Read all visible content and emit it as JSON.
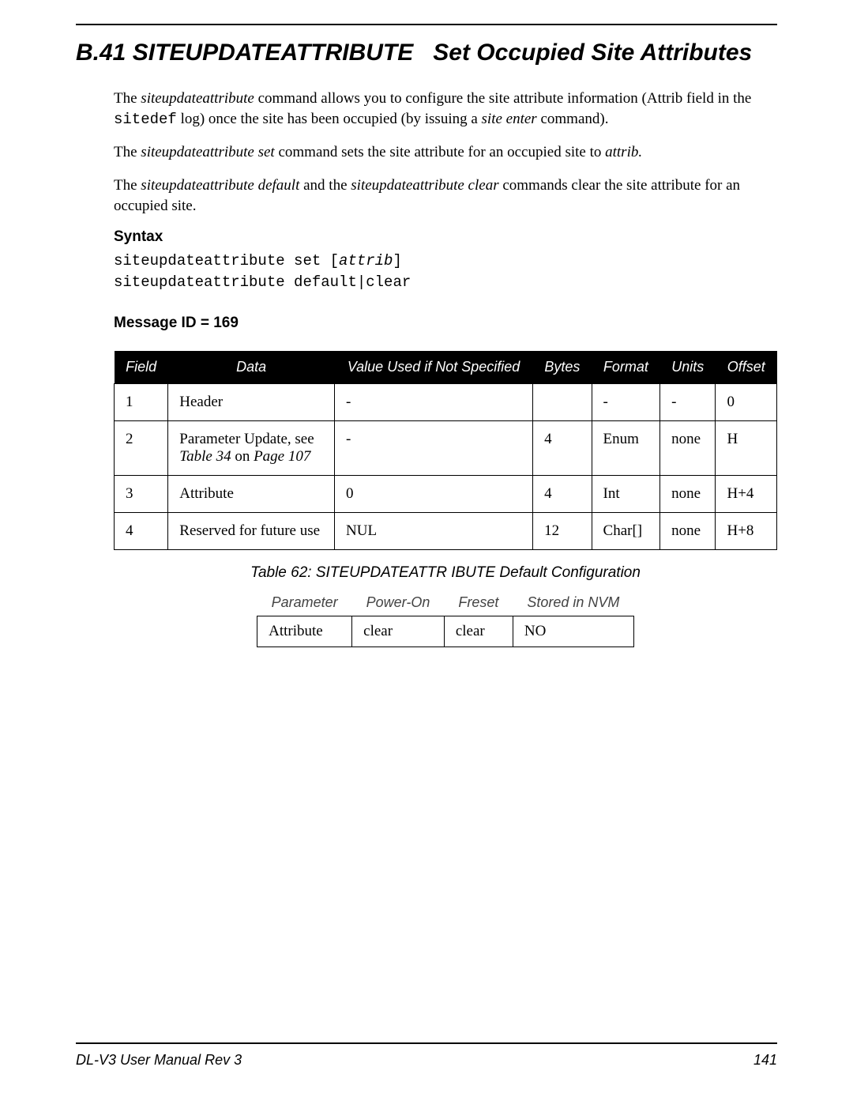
{
  "section": {
    "number": "B.41",
    "title_cmd": "SITEUPDATEATTRIBUTE",
    "title_rest": "Set Occupied Site Attributes"
  },
  "paras": {
    "p1_a": "The ",
    "p1_cmd": "siteupdateattribute",
    "p1_b": " command allows you to configure the site attribute information (Attrib field in the ",
    "p1_code": "sitedef",
    "p1_c": " log) once the site has been occupied (by issuing a ",
    "p1_cmd2": "site enter",
    "p1_d": " command).",
    "p2_a": "The ",
    "p2_cmd": "siteupdateattribute set",
    "p2_b": " command sets the site attribute for an occupied site to ",
    "p2_cmd2": "attrib.",
    "p3_a": "The ",
    "p3_cmd": "siteupdateattribute default",
    "p3_b": " and the ",
    "p3_cmd2": "siteupdateattribute clear",
    "p3_c": " commands clear the site attribute for an occupied site."
  },
  "syntax": {
    "heading": "Syntax",
    "line1_a": "siteupdateattribute set [",
    "line1_arg": "attrib",
    "line1_b": "]",
    "line2": "siteupdateattribute default|clear"
  },
  "msgid_heading": "Message ID = 169",
  "msgtable": {
    "headers": [
      "Field",
      "Data",
      "Value Used if Not Specified",
      "Bytes",
      "Format",
      "Units",
      "Offset"
    ],
    "rows": [
      {
        "field": "1",
        "data": "Header",
        "data_ref": "",
        "vuns": "-",
        "bytes": "",
        "format": "-",
        "units": "-",
        "offset": "0"
      },
      {
        "field": "2",
        "data": "Parameter Update, see ",
        "data_ref": "Table 34",
        "data_ref_tail": " on ",
        "data_ref_page": "Page 107",
        "vuns": "-",
        "bytes": "4",
        "format": "Enum",
        "units": "none",
        "offset": "H"
      },
      {
        "field": "3",
        "data": "Attribute",
        "data_ref": "",
        "vuns": "0",
        "bytes": "4",
        "format": "Int",
        "units": "none",
        "offset": "H+4"
      },
      {
        "field": "4",
        "data": "Reserved for future use",
        "data_ref": "",
        "vuns": "NUL",
        "bytes": "12",
        "format": "Char[]",
        "units": "none",
        "offset": "H+8"
      }
    ]
  },
  "caption": "Table 62: SITEUPDATEATTR IBUTE Default Configuration",
  "deftable": {
    "headers": [
      "Parameter",
      "Power-On",
      "Freset",
      "Stored in NVM"
    ],
    "row": {
      "parameter": "Attribute",
      "poweron": "clear",
      "freset": "clear",
      "nvm": "NO"
    }
  },
  "footer": {
    "left": "DL-V3 User Manual Rev 3",
    "right": "141"
  },
  "chart_data": {
    "type": "table",
    "tables": [
      {
        "name": "message_structure",
        "message_id": 169,
        "columns": [
          "Field",
          "Data",
          "Value Used if Not Specified",
          "Bytes",
          "Format",
          "Units",
          "Offset"
        ],
        "rows": [
          [
            "1",
            "Header",
            "-",
            "",
            "-",
            "-",
            "0"
          ],
          [
            "2",
            "Parameter Update, see Table 34 on Page 107",
            "-",
            "4",
            "Enum",
            "none",
            "H"
          ],
          [
            "3",
            "Attribute",
            "0",
            "4",
            "Int",
            "none",
            "H+4"
          ],
          [
            "4",
            "Reserved for future use",
            "NUL",
            "12",
            "Char[]",
            "none",
            "H+8"
          ]
        ]
      },
      {
        "name": "default_configuration",
        "caption": "Table 62: SITEUPDATEATTRIBUTE Default Configuration",
        "columns": [
          "Parameter",
          "Power-On",
          "Freset",
          "Stored in NVM"
        ],
        "rows": [
          [
            "Attribute",
            "clear",
            "clear",
            "NO"
          ]
        ]
      }
    ]
  }
}
